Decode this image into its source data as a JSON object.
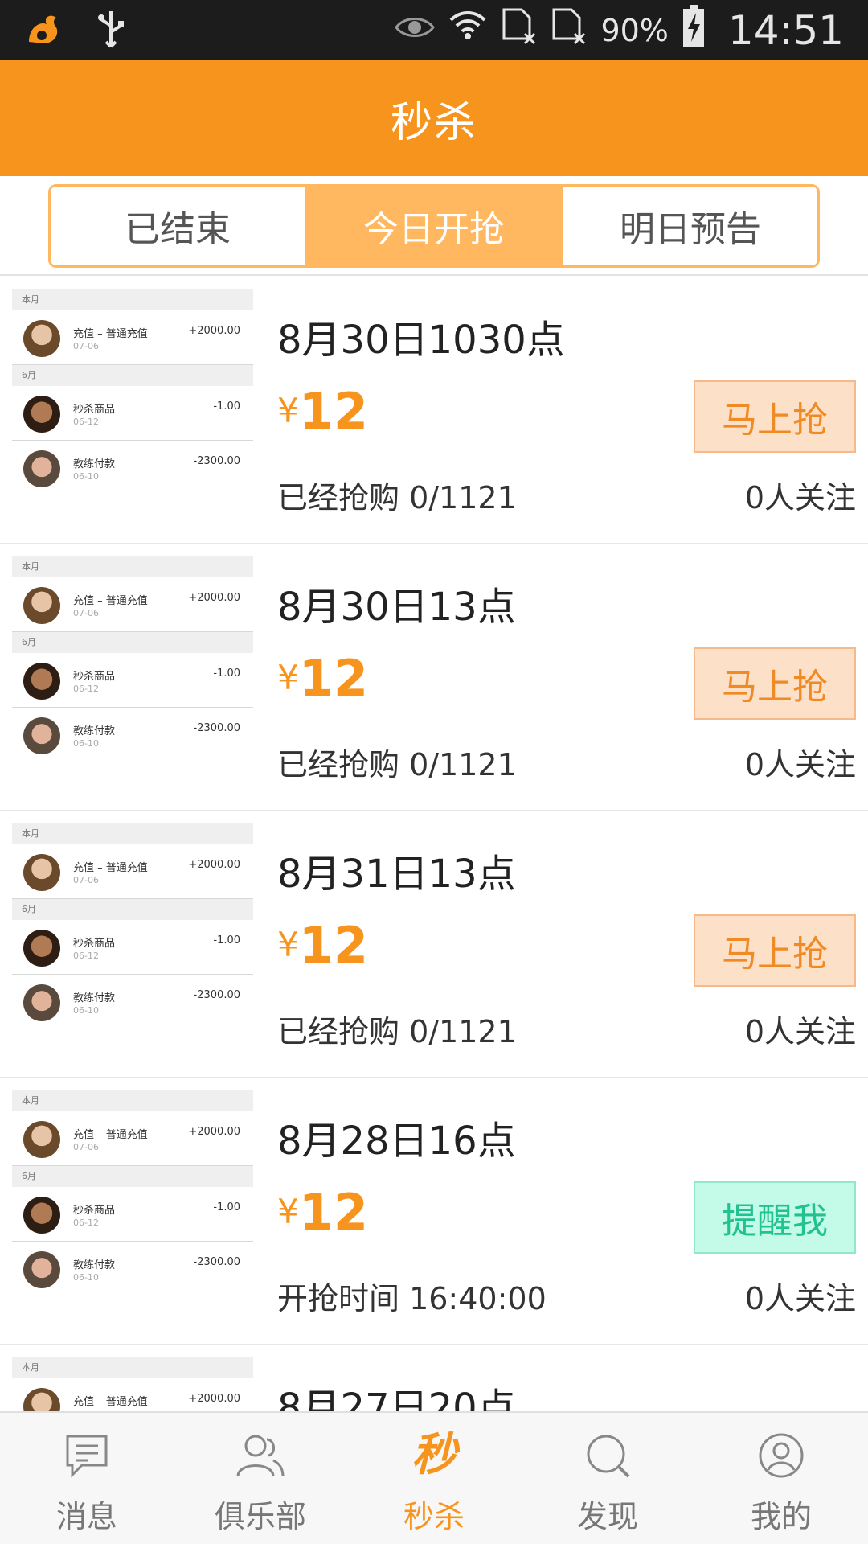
{
  "status_bar": {
    "battery": "90%",
    "time": "14:51"
  },
  "header": {
    "title": "秒杀"
  },
  "tabs": [
    {
      "label": "已结束"
    },
    {
      "label": "今日开抢",
      "active": true
    },
    {
      "label": "明日预告"
    }
  ],
  "thumbnail": {
    "section_this_month": "本月",
    "section_june": "6月",
    "rows": [
      {
        "name": "充值 – 普通充值",
        "date": "07-06",
        "amount": "+2000.00"
      },
      {
        "name": "秒杀商品",
        "date": "06-12",
        "amount": "-1.00"
      },
      {
        "name": "教练付款",
        "date": "06-10",
        "amount": "-2300.00"
      }
    ]
  },
  "items": [
    {
      "title": "8月30日1030点",
      "currency": "¥",
      "price": "12",
      "button": "马上抢",
      "button_type": "grab",
      "progress": "已经抢购 0/1121",
      "followers": "0人关注"
    },
    {
      "title": "8月30日13点",
      "currency": "¥",
      "price": "12",
      "button": "马上抢",
      "button_type": "grab",
      "progress": "已经抢购 0/1121",
      "followers": "0人关注"
    },
    {
      "title": "8月31日13点",
      "currency": "¥",
      "price": "12",
      "button": "马上抢",
      "button_type": "grab",
      "progress": "已经抢购 0/1121",
      "followers": "0人关注"
    },
    {
      "title": "8月28日16点",
      "currency": "¥",
      "price": "12",
      "button": "提醒我",
      "button_type": "remind",
      "progress": "开抢时间 16:40:00",
      "followers": "0人关注"
    },
    {
      "title": "8月27日20点"
    }
  ],
  "bottom_nav": [
    {
      "label": "消息",
      "icon": "message-icon"
    },
    {
      "label": "俱乐部",
      "icon": "club-icon"
    },
    {
      "label": "秒杀",
      "icon": "flash-sale-icon",
      "glyph": "秒",
      "active": true
    },
    {
      "label": "发现",
      "icon": "discover-icon"
    },
    {
      "label": "我的",
      "icon": "profile-icon"
    }
  ],
  "colors": {
    "brand": "#f7941d",
    "tab_active": "#ffb760",
    "grab_button_bg": "#fde0c8",
    "remind_button_bg": "#c4fae8"
  }
}
